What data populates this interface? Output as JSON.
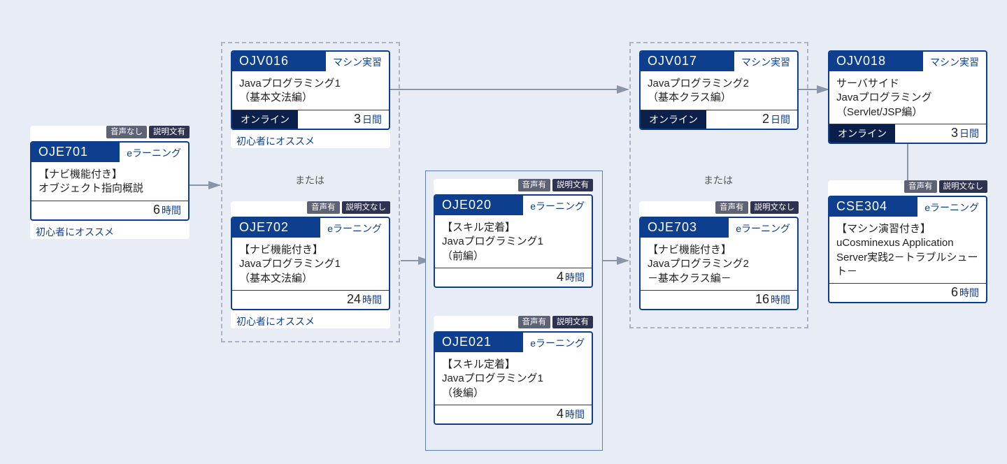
{
  "or_label": "または",
  "beginner_rec": "初心者にオススメ",
  "units": {
    "hours": "時間",
    "days": "日間"
  },
  "types": {
    "elearn": "eラーニング",
    "machine": "マシン実習"
  },
  "footer_online": "オンライン",
  "tag_labels": {
    "audio_yes": "音声有",
    "audio_no": "音声なし",
    "desc_yes": "説明文有",
    "desc_no": "説明文なし"
  },
  "cards": {
    "oje701": {
      "code": "OJE701",
      "title": "【ナビ機能付き】\nオブジェクト指向概説",
      "duration": "6"
    },
    "ojv016": {
      "code": "OJV016",
      "title": "Javaプログラミング1\n（基本文法編）",
      "duration": "3"
    },
    "oje702": {
      "code": "OJE702",
      "title": "【ナビ機能付き】\nJavaプログラミング1\n（基本文法編）",
      "duration": "24"
    },
    "oje020": {
      "code": "OJE020",
      "title": "【スキル定着】\nJavaプログラミング1\n（前編）",
      "duration": "4"
    },
    "oje021": {
      "code": "OJE021",
      "title": "【スキル定着】\nJavaプログラミング1\n（後編）",
      "duration": "4"
    },
    "ojv017": {
      "code": "OJV017",
      "title": "Javaプログラミング2\n（基本クラス編）",
      "duration": "2"
    },
    "oje703": {
      "code": "OJE703",
      "title": "【ナビ機能付き】\nJavaプログラミング2\n－基本クラス編－",
      "duration": "16"
    },
    "ojv018": {
      "code": "OJV018",
      "title": "サーバサイド\nJavaプログラミング\n（Servlet/JSP編）",
      "duration": "3"
    },
    "cse304": {
      "code": "CSE304",
      "title": "【マシン演習付き】\nuCosminexus Application Server実践2－トラブルシュート－",
      "duration": "6"
    }
  }
}
